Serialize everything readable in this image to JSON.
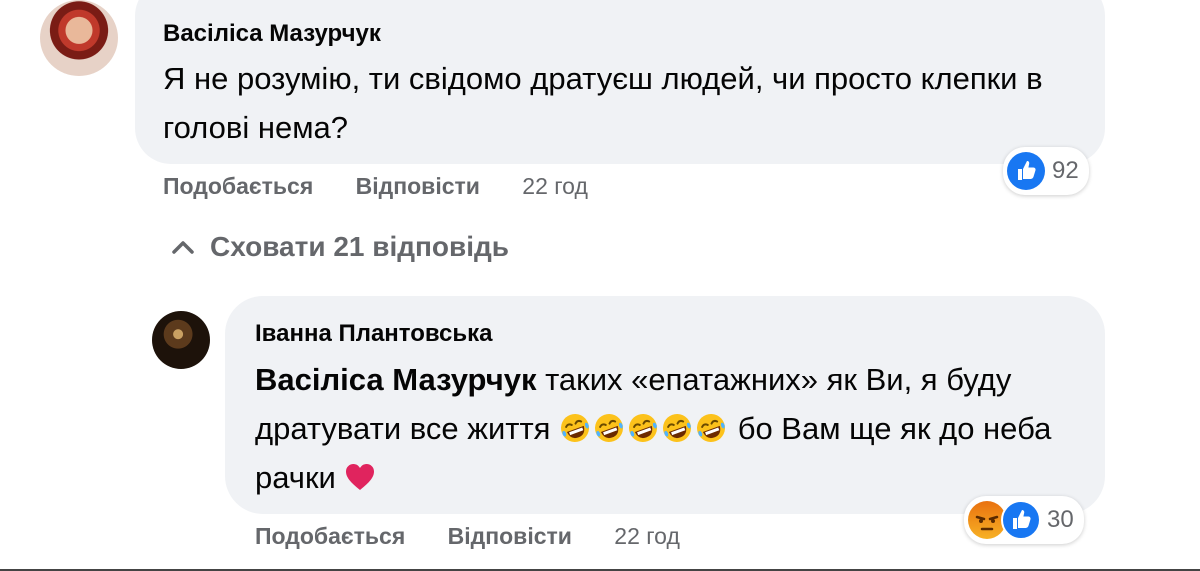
{
  "comment": {
    "author": "Васіліса Мазурчук",
    "text": "Я не розумію, ти свідомо дратуєш людей, чи просто клепки в голові нема?",
    "actions": {
      "like": "Подобається",
      "reply": "Відповісти",
      "time": "22 год"
    },
    "reactions": {
      "icons": [
        "like-icon"
      ],
      "count": "92"
    }
  },
  "hide_replies": {
    "label": "Сховати 21 відповідь"
  },
  "reply": {
    "author": "Іванна Плантовська",
    "mention": "Васіліса Мазурчук",
    "text_part1": " таких «епатажних» як Ви, я буду дратувати все життя ",
    "text_part2": " бо Вам ще як до неба рачки ",
    "emoji_laughing_count": 5,
    "actions": {
      "like": "Подобається",
      "reply": "Відповісти",
      "time": "22 год"
    },
    "reactions": {
      "icons": [
        "angry-icon",
        "like-icon"
      ],
      "count": "30"
    }
  },
  "colors": {
    "bubble_bg": "#f0f2f5",
    "meta_text": "#65676b",
    "like_blue": "#1877f2",
    "heart_red": "#e0245e",
    "angry_orange": "#e9710f"
  }
}
